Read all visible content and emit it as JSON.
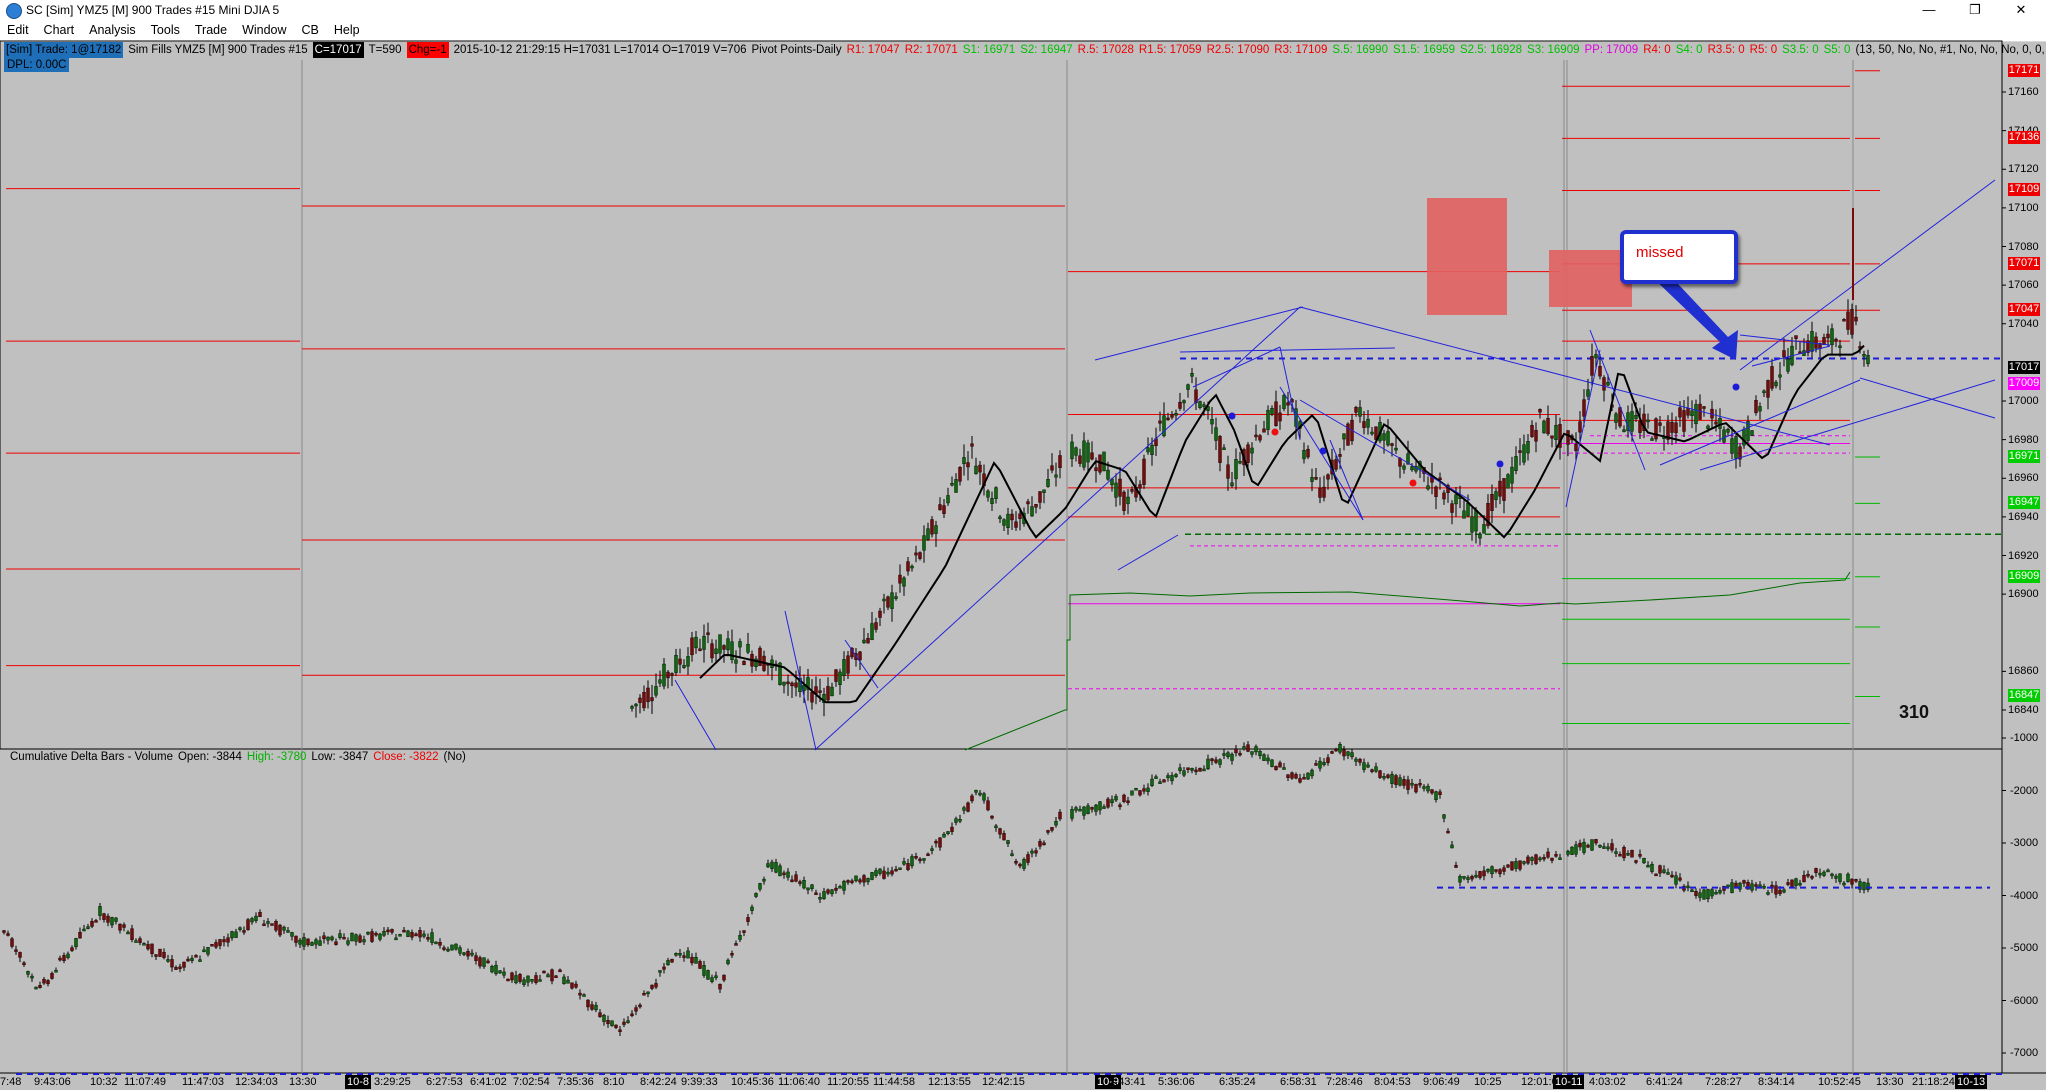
{
  "window": {
    "title": "SC [Sim] YMZ5 [M]  900 Trades  #15  Mini DJIA 5",
    "minimize": "—",
    "restore": "❐",
    "close": "✕"
  },
  "menu": [
    "Edit",
    "Chart",
    "Analysis",
    "Tools",
    "Trade",
    "Window",
    "CB",
    "Help"
  ],
  "info_bar": {
    "sim_tag": "[Sim]  Trade: 1@17182",
    "fills": "Sim Fills  YMZ5 [M]  900 Trades  #15",
    "close_tag": "C=17017",
    "t_val": "T=590",
    "chg_tag": "Chg=-1",
    "date_line": "2015-10-12 21:29:15 H=17031 L=17014 O=17019 V=706",
    "study": "Pivot Points-Daily",
    "r_items": [
      "R1: 17047",
      "R2: 17071"
    ],
    "s_items": [
      "S1: 16971",
      "S2: 16947"
    ],
    "r_items2": [
      "R.5: 17028",
      "R1.5: 17059",
      "R2.5: 17090",
      "R3: 17109"
    ],
    "s_items2": [
      "S.5: 16990",
      "S1.5: 16959",
      "S2.5: 16928",
      "S3: 16909"
    ],
    "pp": "PP: 17009",
    "r_zero": [
      "R4: 0"
    ],
    "s_zero": [
      "S4: 0"
    ],
    "r_zero2": [
      "R3.5: 0",
      "R5: 0"
    ],
    "s_zero2": [
      "S3.5: 0",
      "S5: 0"
    ],
    "tail": "(13, 50, No, No, #1, No, No, No, 0, 0, 0,",
    "dpl": "DPL: 0.00C"
  },
  "annotations": {
    "callout": "missed",
    "count": "310"
  },
  "price_axis": {
    "labels": [
      "17160",
      "17140",
      "17120",
      "17100",
      "17080",
      "17060",
      "17040",
      "17000",
      "16980",
      "16960",
      "16940",
      "16920",
      "16900",
      "16860",
      "16840"
    ],
    "tags": [
      {
        "text": "17171",
        "color": "#ee0000",
        "fg": "#ffffff"
      },
      {
        "text": "17136",
        "color": "#ee0000",
        "fg": "#ffffff"
      },
      {
        "text": "17109",
        "color": "#ee0000",
        "fg": "#ffffff"
      },
      {
        "text": "17071",
        "color": "#ee0000",
        "fg": "#ffffff"
      },
      {
        "text": "17047",
        "color": "#ee0000",
        "fg": "#ffffff"
      },
      {
        "text": "17017",
        "color": "#000000",
        "fg": "#ffffff"
      },
      {
        "text": "17009",
        "color": "#ff00ff",
        "fg": "#ffffff"
      },
      {
        "text": "16971",
        "color": "#00cc00",
        "fg": "#ffffff"
      },
      {
        "text": "16947",
        "color": "#00cc00",
        "fg": "#ffffff"
      },
      {
        "text": "16909",
        "color": "#00cc00",
        "fg": "#ffffff"
      },
      {
        "text": "16847",
        "color": "#00cc00",
        "fg": "#ffffff"
      }
    ]
  },
  "subgraph": {
    "title": "Cumulative Delta Bars - Volume",
    "open": "Open: -3844",
    "high": "High: -3780",
    "low": "Low: -3847",
    "close": "Close: -3822",
    "flag": "(No)",
    "axis_labels": [
      "-1000",
      "-2000",
      "-3000",
      "-4000",
      "-5000",
      "-6000",
      "-7000"
    ]
  },
  "time_axis": [
    {
      "text": "7:48",
      "day": false
    },
    {
      "text": "9:43:06",
      "day": false
    },
    {
      "text": "10:32",
      "day": false
    },
    {
      "text": "11:07:49",
      "day": false
    },
    {
      "text": "11:47:03",
      "day": false
    },
    {
      "text": "12:34:03",
      "day": false
    },
    {
      "text": "13:30",
      "day": false
    },
    {
      "text": "10-8",
      "day": true
    },
    {
      "text": "3:29:25",
      "day": false
    },
    {
      "text": "6:27:53",
      "day": false
    },
    {
      "text": "6:41:02",
      "day": false
    },
    {
      "text": "7:02:54",
      "day": false
    },
    {
      "text": "7:35:36",
      "day": false
    },
    {
      "text": "8:10",
      "day": false
    },
    {
      "text": "8:42:24",
      "day": false
    },
    {
      "text": "9:39:33",
      "day": false
    },
    {
      "text": "10:45:36",
      "day": false
    },
    {
      "text": "11:06:40",
      "day": false
    },
    {
      "text": "11:20:55",
      "day": false
    },
    {
      "text": "11:44:58",
      "day": false
    },
    {
      "text": "12:13:55",
      "day": false
    },
    {
      "text": "12:42:15",
      "day": false
    },
    {
      "text": "10-9",
      "day": true
    },
    {
      "text": "2:43:41",
      "day": false
    },
    {
      "text": "5:36:06",
      "day": false
    },
    {
      "text": "6:35:24",
      "day": false
    },
    {
      "text": "6:58:31",
      "day": false
    },
    {
      "text": "7:28:46",
      "day": false
    },
    {
      "text": "8:04:53",
      "day": false
    },
    {
      "text": "9:06:49",
      "day": false
    },
    {
      "text": "10:25",
      "day": false
    },
    {
      "text": "12:01:07",
      "day": false
    },
    {
      "text": "10-11",
      "day": true
    },
    {
      "text": "4:03:02",
      "day": false
    },
    {
      "text": "6:41:24",
      "day": false
    },
    {
      "text": "7:28:27",
      "day": false
    },
    {
      "text": "8:34:14",
      "day": false
    },
    {
      "text": "10:52:45",
      "day": false
    },
    {
      "text": "13:30",
      "day": false
    },
    {
      "text": "21:18:24",
      "day": false
    },
    {
      "text": "10-13",
      "day": true
    }
  ],
  "colors": {
    "background": "#c0c0c0",
    "up_bar": "#0a6a0a",
    "down_bar": "#7a0a0a",
    "resistance": "#ee0000",
    "support": "#00cc00",
    "pivot": "#ee00ee",
    "trendline": "#2222dd",
    "zone": "#e26060"
  }
}
